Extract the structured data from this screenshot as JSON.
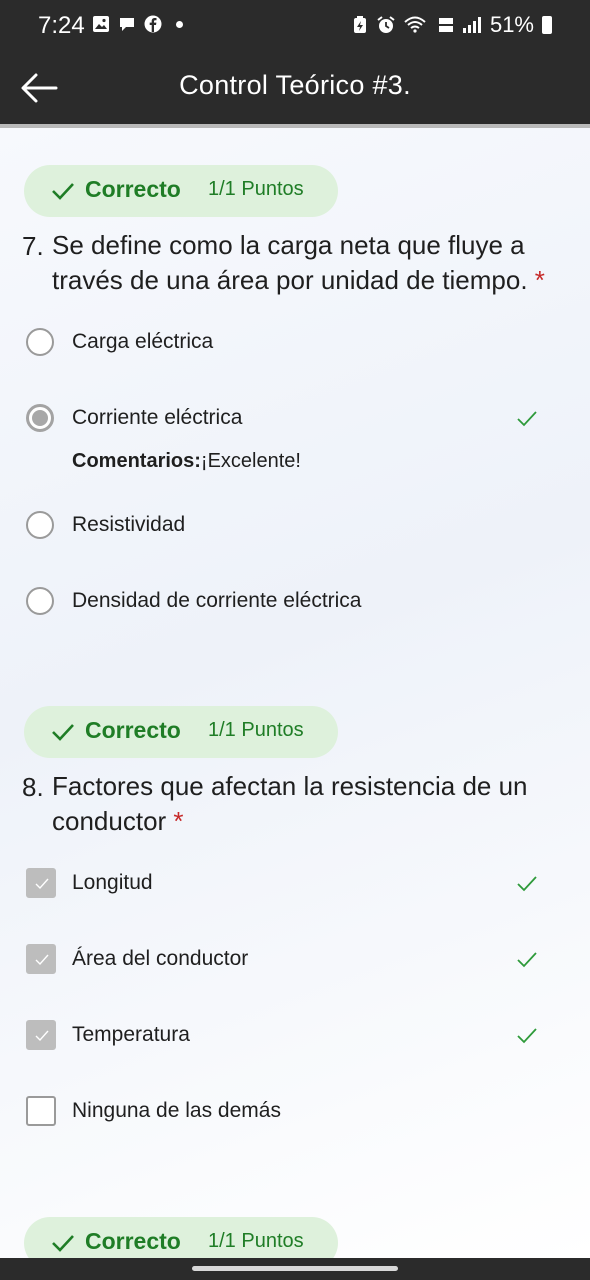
{
  "status_bar": {
    "time": "7:24",
    "battery": "51%",
    "icons": [
      "image-icon",
      "chat-icon",
      "facebook-icon",
      "dot-icon",
      "battery-saver-icon",
      "alarm-icon",
      "wifi-icon",
      "volte-icon",
      "signal-icon",
      "battery-icon"
    ]
  },
  "app_bar": {
    "title": "Control Teórico #3.",
    "back_icon": "arrow-left-icon"
  },
  "questions": [
    {
      "badge_label": "Correcto",
      "badge_points": "1/1 Puntos",
      "number": "7.",
      "text": "Se define como la carga neta que fluye a través de una área por unidad de tiempo.",
      "required_mark": "*",
      "type": "radio",
      "options": [
        {
          "label": "Carga eléctrica",
          "selected": false,
          "correct_mark": false
        },
        {
          "label": "Corriente eléctrica",
          "selected": true,
          "correct_mark": true
        },
        {
          "label": "Resistividad",
          "selected": false,
          "correct_mark": false
        },
        {
          "label": "Densidad de corriente eléctrica",
          "selected": false,
          "correct_mark": false
        }
      ],
      "feedback_label": "Comentarios:",
      "feedback_text": "¡Excelente!"
    },
    {
      "badge_label": "Correcto",
      "badge_points": "1/1 Puntos",
      "number": "8.",
      "text": "Factores que afectan la resistencia de un conductor",
      "required_mark": "*",
      "type": "checkbox",
      "options": [
        {
          "label": "Longitud",
          "selected": true,
          "correct_mark": true
        },
        {
          "label": "Área del conductor",
          "selected": true,
          "correct_mark": true
        },
        {
          "label": "Temperatura",
          "selected": true,
          "correct_mark": true
        },
        {
          "label": "Ninguna de las demás",
          "selected": false,
          "correct_mark": false
        }
      ]
    },
    {
      "badge_label": "Correcto",
      "badge_points": "1/1 Puntos"
    }
  ],
  "colors": {
    "bar_bg": "#2b2b2b",
    "badge_bg": "#def1dc",
    "correct_green": "#1f7d26",
    "required_red": "#c62828"
  }
}
